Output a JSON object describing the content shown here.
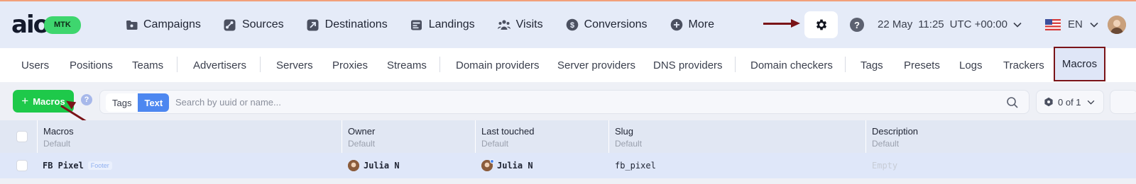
{
  "brand": {
    "logo_text": "aio",
    "badge": "MTK",
    "badge_color": "#3ed66e"
  },
  "nav": [
    {
      "label": "Campaigns",
      "icon": "folder-icon"
    },
    {
      "label": "Sources",
      "icon": "share-icon"
    },
    {
      "label": "Destinations",
      "icon": "arrow-out-icon"
    },
    {
      "label": "Landings",
      "icon": "landing-icon"
    },
    {
      "label": "Visits",
      "icon": "users-icon"
    },
    {
      "label": "Conversions",
      "icon": "dollar-badge-icon"
    },
    {
      "label": "More",
      "icon": "plus-circle-icon"
    }
  ],
  "header_right": {
    "settings_icon": "gear-icon",
    "help_icon": "question-icon",
    "help_text": "?",
    "date": "22 May",
    "time": "11:25",
    "timezone": "UTC +00:00",
    "language": "EN",
    "language_flag": "us-flag-icon"
  },
  "tabs": [
    {
      "label": "Users"
    },
    {
      "label": "Positions"
    },
    {
      "label": "Teams"
    },
    {
      "label": "Advertisers"
    },
    {
      "label": "Servers"
    },
    {
      "label": "Proxies"
    },
    {
      "label": "Streams"
    },
    {
      "label": "Domain providers"
    },
    {
      "label": "Server providers"
    },
    {
      "label": "DNS providers"
    },
    {
      "label": "Domain checkers"
    },
    {
      "label": "Tags"
    },
    {
      "label": "Presets"
    },
    {
      "label": "Logs"
    },
    {
      "label": "Trackers"
    },
    {
      "label": "Macros",
      "active": true
    }
  ],
  "toolbar": {
    "add_label": "Macros",
    "add_icon": "plus-icon",
    "hint_text": "?",
    "search_modes": [
      "Tags",
      "Text"
    ],
    "active_mode": "Text",
    "search_placeholder": "Search by uuid or name...",
    "search_value": "",
    "pager": "0 of 1"
  },
  "table": {
    "columns": [
      {
        "title": "Macros",
        "subtitle": "Default"
      },
      {
        "title": "Owner",
        "subtitle": "Default"
      },
      {
        "title": "Last touched",
        "subtitle": "Default"
      },
      {
        "title": "Slug",
        "subtitle": "Default"
      },
      {
        "title": "Description",
        "subtitle": "Default"
      }
    ],
    "rows": [
      {
        "name": "FB Pixel",
        "tag": "Footer",
        "owner": "Julia N",
        "last_touched": "Julia N",
        "slug": "fb_pixel",
        "description": "Empty"
      }
    ]
  },
  "colors": {
    "accent": "#4d87f0",
    "primary_button": "#1ec94a",
    "annotation": "#7a1418"
  }
}
